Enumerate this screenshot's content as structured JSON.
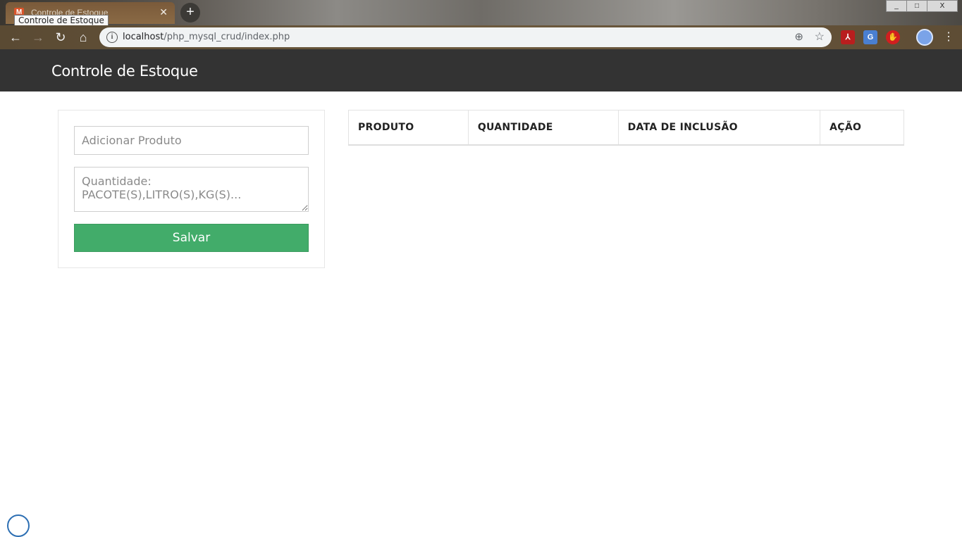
{
  "browser": {
    "tab_title": "Controle de Estoque",
    "tooltip": "Controle de Estoque",
    "favicon": "M",
    "new_tab_icon": "plus-icon",
    "url_host": "localhost",
    "url_path": "/php_mysql_crud/index.php",
    "window_controls": [
      "_",
      "□",
      "X"
    ]
  },
  "navbar": {
    "brand": "Controle de Estoque"
  },
  "form": {
    "product_placeholder": "Adicionar Produto",
    "quantity_placeholder": "Quantidade: PACOTE(S),LITRO(S),KG(S)...",
    "save_label": "Salvar",
    "save_color": "#42ac6a"
  },
  "table": {
    "headers": [
      "PRODUTO",
      "QUANTIDADE",
      "DATA DE INCLUSÃO",
      "AÇÃO"
    ],
    "rows": []
  },
  "colors": {
    "navbar_bg": "#333333",
    "accent_green": "#42ac6a"
  }
}
